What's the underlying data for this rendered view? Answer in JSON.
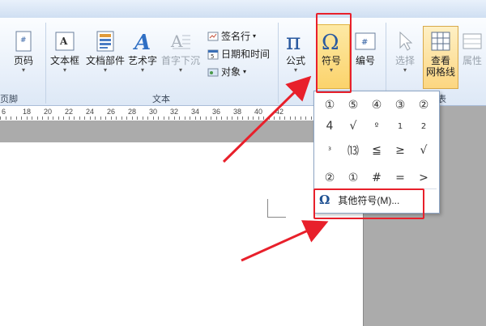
{
  "ribbon": {
    "header_footer": {
      "page_num_label": "页码",
      "group_label": "页脚"
    },
    "text_group": {
      "group_label": "文本",
      "textbox_label": "文本框",
      "quickparts_label": "文档部件",
      "wordart_label": "艺术字",
      "dropcap_label": "首字下沉",
      "signature_label": "签名行",
      "datetime_label": "日期和时间",
      "object_label": "对象"
    },
    "symbols_group": {
      "equation_label": "公式",
      "symbol_label": "符号",
      "numbering_label": "编号"
    },
    "select_label": "选择",
    "gridlines_label": "查看\n网格线",
    "gridlines_line1": "查看",
    "gridlines_line2": "网格线",
    "properties_label": "属性",
    "table_group_label": "表"
  },
  "ruler": {
    "numbers": [
      "6",
      "18",
      "20",
      "22",
      "24",
      "26",
      "28",
      "30",
      "32",
      "34",
      "36",
      "38",
      "40",
      "42"
    ]
  },
  "symbol_menu": {
    "symbols": [
      [
        "①",
        "⑤",
        "④",
        "③",
        "②"
      ],
      [
        "4",
        "√",
        "º",
        "1",
        "2"
      ],
      [
        "³",
        "⒀",
        "≦",
        "≥",
        "√"
      ],
      [
        "②",
        "①",
        "#",
        "=",
        ">"
      ]
    ],
    "more_label": "其他符号(M)..."
  },
  "colors": {
    "highlight": "#e8202b",
    "arrow": "#e8202b"
  }
}
